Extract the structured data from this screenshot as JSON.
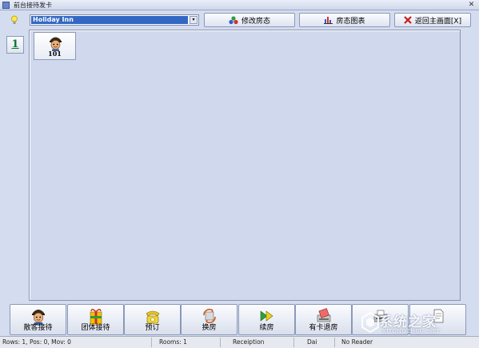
{
  "window": {
    "title": "前台接待发卡",
    "close_icon": "close-icon"
  },
  "toolbar": {
    "hotel_select": {
      "value": "Holiday Inn"
    },
    "buttons": [
      {
        "label": "修改房态",
        "icon": "room-status-icon"
      },
      {
        "label": "房态图表",
        "icon": "bar-chart-icon"
      },
      {
        "label": "返回主画面[X]",
        "icon": "red-x-icon"
      }
    ]
  },
  "floors": [
    {
      "label": "1"
    }
  ],
  "rooms": [
    {
      "number": "101",
      "icon": "guest-face-icon"
    }
  ],
  "actions": [
    {
      "label": "散客接待",
      "icon": "guest-icon"
    },
    {
      "label": "团体接待",
      "icon": "group-icon"
    },
    {
      "label": "预订",
      "icon": "phone-icon"
    },
    {
      "label": "换房",
      "icon": "swap-room-icon"
    },
    {
      "label": "续房",
      "icon": "extend-icon"
    },
    {
      "label": "有卡退房",
      "icon": "checkout-card-icon"
    },
    {
      "label": "",
      "icon": "card-writer-icon"
    },
    {
      "label": "",
      "icon": "document-icon"
    }
  ],
  "statusbar": {
    "rows": "Rows: 1, Pos: 0, Mov: 0",
    "rooms": "Rooms:  1",
    "role": "Receiption",
    "user": "Dai",
    "reader": "No Reader"
  },
  "watermark": {
    "text": "系统之家",
    "url": "XITONGZHIJIA.NET"
  },
  "colors": {
    "background": "#d4dcef",
    "panel": "#cfd8ec",
    "select_highlight": "#3268c4",
    "floor_label": "#0a7a2a"
  }
}
